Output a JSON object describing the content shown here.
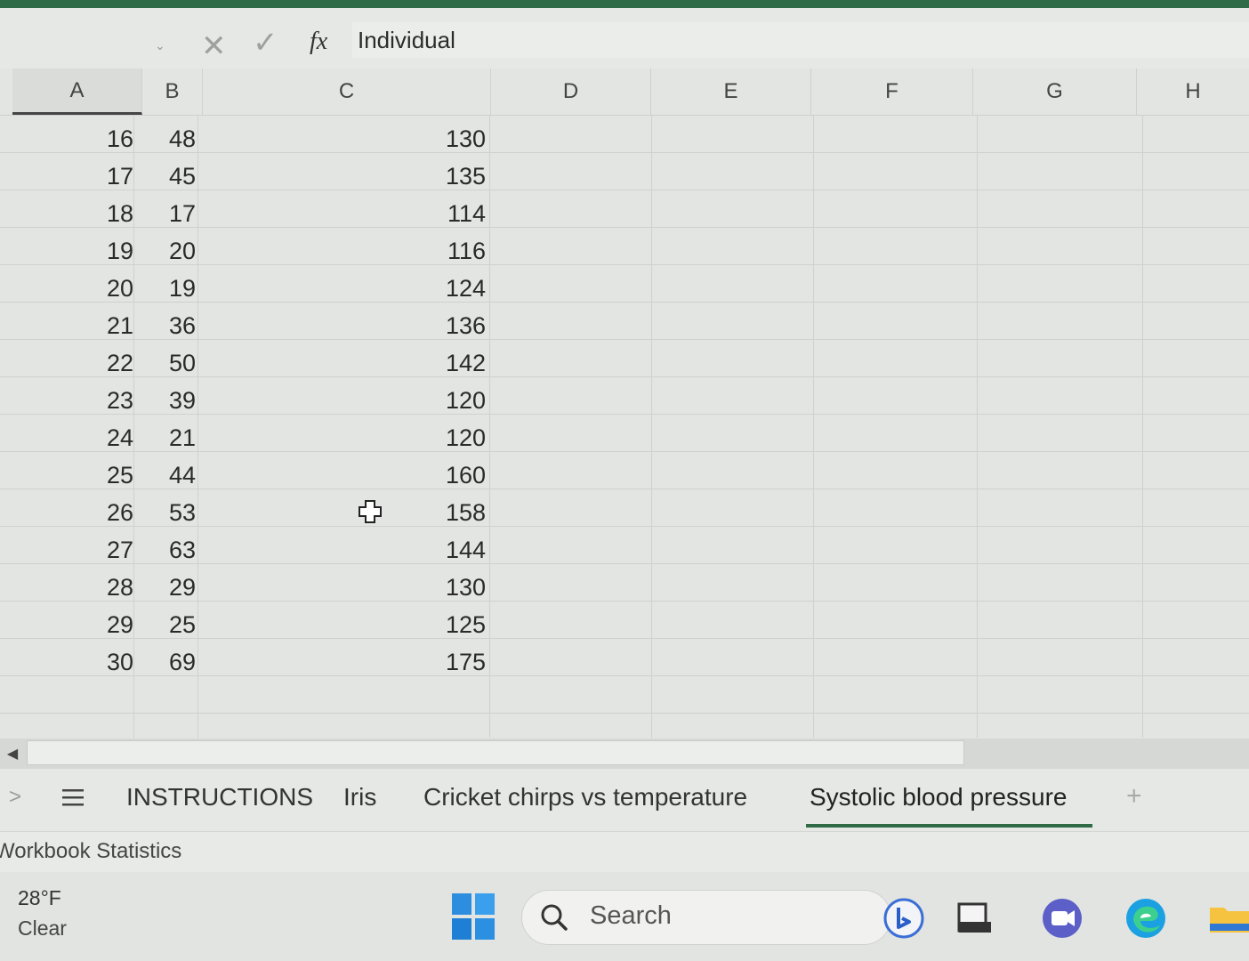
{
  "formula_bar": {
    "fx_label": "fx",
    "value": "Individual"
  },
  "columns": [
    "A",
    "B",
    "C",
    "D",
    "E",
    "F",
    "G",
    "H"
  ],
  "rows": [
    {
      "a": "16",
      "b": "48",
      "c": "130"
    },
    {
      "a": "17",
      "b": "45",
      "c": "135"
    },
    {
      "a": "18",
      "b": "17",
      "c": "114"
    },
    {
      "a": "19",
      "b": "20",
      "c": "116"
    },
    {
      "a": "20",
      "b": "19",
      "c": "124"
    },
    {
      "a": "21",
      "b": "36",
      "c": "136"
    },
    {
      "a": "22",
      "b": "50",
      "c": "142"
    },
    {
      "a": "23",
      "b": "39",
      "c": "120"
    },
    {
      "a": "24",
      "b": "21",
      "c": "120"
    },
    {
      "a": "25",
      "b": "44",
      "c": "160"
    },
    {
      "a": "26",
      "b": "53",
      "c": "158"
    },
    {
      "a": "27",
      "b": "63",
      "c": "144"
    },
    {
      "a": "28",
      "b": "29",
      "c": "130"
    },
    {
      "a": "29",
      "b": "25",
      "c": "125"
    },
    {
      "a": "30",
      "b": "69",
      "c": "175"
    }
  ],
  "sheet_tabs": {
    "items": [
      "INSTRUCTIONS",
      "Iris",
      "Cricket chirps vs temperature",
      "Systolic blood pressure"
    ],
    "active": "Systolic blood pressure"
  },
  "status_bar": {
    "text": "Workbook Statistics"
  },
  "taskbar": {
    "weather_temp": "28°F",
    "weather_condition": "Clear",
    "search_label": "Search"
  },
  "colors": {
    "accent": "#2f6b46",
    "grid_bg": "#e3e5e2"
  }
}
